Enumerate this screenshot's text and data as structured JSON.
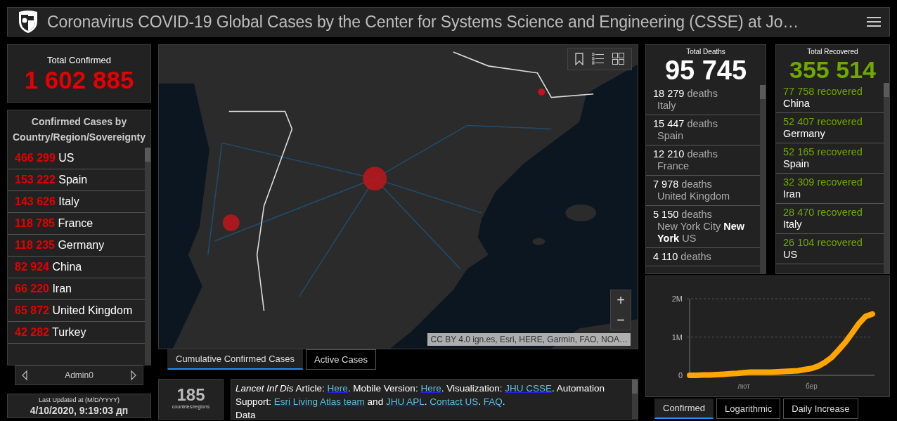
{
  "header": {
    "title": "Coronavirus COVID-19 Global Cases by the Center for Systems Science and Engineering (CSSE) at Jo…"
  },
  "total_confirmed": {
    "label": "Total Confirmed",
    "value": "1 602 885"
  },
  "confirmed_by_country": {
    "title": "Confirmed Cases by Country/Region/Sovereignty",
    "rows": [
      {
        "count": "466 299",
        "place": "US"
      },
      {
        "count": "153 222",
        "place": "Spain"
      },
      {
        "count": "143 626",
        "place": "Italy"
      },
      {
        "count": "118 785",
        "place": "France"
      },
      {
        "count": "118 235",
        "place": "Germany"
      },
      {
        "count": "82 924",
        "place": "China"
      },
      {
        "count": "66 220",
        "place": "Iran"
      },
      {
        "count": "65 872",
        "place": "United Kingdom"
      },
      {
        "count": "42 282",
        "place": "Turkey"
      }
    ]
  },
  "pager": {
    "label": "Admin0"
  },
  "last_updated": {
    "label": "Last Updated at (M/D/YYYY)",
    "value": "4/10/2020, 9:19:03 дп"
  },
  "map": {
    "zoom_in": "+",
    "zoom_out": "−",
    "attribution": "CC BY 4.0 ign.es, Esri, HERE, Garmin, FAO, NOA…"
  },
  "map_tabs": [
    {
      "label": "Cumulative Confirmed Cases",
      "selected": true
    },
    {
      "label": "Active Cases",
      "selected": false
    }
  ],
  "country_count": {
    "value": "185",
    "label": "countries/regions"
  },
  "info": {
    "paragraphs": [
      [
        {
          "kind": "text",
          "text": "*Lancet Inf Dis* Article: "
        },
        {
          "kind": "link",
          "text": "Here"
        },
        {
          "kind": "text",
          "text": ". Mobile Version: "
        },
        {
          "kind": "link",
          "text": "Here"
        },
        {
          "kind": "text",
          "text": ". Visualization: "
        },
        {
          "kind": "link",
          "text": "JHU CSSE"
        },
        {
          "kind": "text",
          "text": ". Automation Support: "
        },
        {
          "kind": "link",
          "text": "Esri Living Atlas team"
        },
        {
          "kind": "text",
          "text": " and "
        },
        {
          "kind": "link",
          "text": "JHU APL"
        },
        {
          "kind": "text",
          "text": ". "
        },
        {
          "kind": "link",
          "text": "Contact US"
        },
        {
          "kind": "text",
          "text": ". "
        },
        {
          "kind": "link",
          "text": "FAQ"
        },
        {
          "kind": "text",
          "text": "."
        }
      ],
      [
        {
          "kind": "text",
          "text": "Data"
        }
      ]
    ]
  },
  "total_deaths": {
    "label": "Total Deaths",
    "value": "95 745",
    "rows": [
      {
        "count": "18 279",
        "unit": "deaths",
        "place": "Italy"
      },
      {
        "count": "15 447",
        "unit": "deaths",
        "place": "Spain"
      },
      {
        "count": "12 210",
        "unit": "deaths",
        "place": "France"
      },
      {
        "count": "7 978",
        "unit": "deaths",
        "place": "United Kingdom"
      },
      {
        "count": "5 150",
        "unit": "deaths",
        "place": "New York City **New York** US"
      },
      {
        "count": "4 110",
        "unit": "deaths"
      }
    ]
  },
  "total_recovered": {
    "label": "Total Recovered",
    "value": "355 514",
    "rows": [
      {
        "count": "77 758",
        "unit": "recovered",
        "place": "China"
      },
      {
        "count": "52 407",
        "unit": "recovered",
        "place": "Germany"
      },
      {
        "count": "52 165",
        "unit": "recovered",
        "place": "Spain"
      },
      {
        "count": "32 309",
        "unit": "recovered",
        "place": "Iran"
      },
      {
        "count": "28 470",
        "unit": "recovered",
        "place": "Italy"
      },
      {
        "count": "26 104",
        "unit": "recovered",
        "place": "US"
      }
    ]
  },
  "chart": {
    "chart_data": {
      "type": "line",
      "categories": [
        null,
        null,
        null,
        null,
        null,
        null,
        null,
        null,
        "лют",
        null,
        null,
        null,
        null,
        null,
        null,
        null,
        null,
        null,
        "бер",
        null,
        null,
        null,
        null,
        null,
        null,
        null,
        null,
        null
      ],
      "series": [
        {
          "color": "#ffa500",
          "values": [
            0,
            0,
            10000,
            10000,
            20000,
            30000,
            40000,
            50000,
            70000,
            80000,
            80000,
            80000,
            80000,
            90000,
            100000,
            110000,
            120000,
            150000,
            180000,
            240000,
            340000,
            470000,
            660000,
            860000,
            1100000,
            1350000,
            1540000,
            1600000
          ]
        }
      ],
      "ylim": [
        0,
        2000000
      ],
      "yticks": [
        {
          "value": 0,
          "label": "0"
        },
        {
          "value": 1000000,
          "label": "1M"
        },
        {
          "value": 2000000,
          "label": "2M"
        }
      ]
    }
  },
  "chart_tabs": [
    {
      "label": "Confirmed",
      "selected": true
    },
    {
      "label": "Logarithmic",
      "selected": false
    },
    {
      "label": "Daily Increase",
      "selected": false
    }
  ]
}
